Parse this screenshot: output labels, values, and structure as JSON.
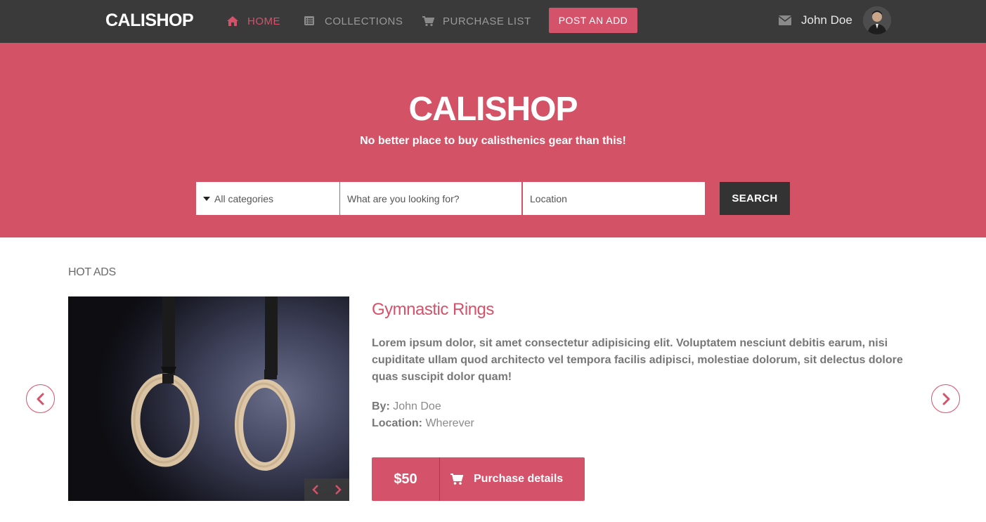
{
  "nav": {
    "brand": "CALISHOP",
    "items": [
      {
        "label": "HOME",
        "icon": "home-icon",
        "active": true
      },
      {
        "label": "COLLECTIONS",
        "icon": "list-icon",
        "active": false
      },
      {
        "label": "PURCHASE LIST",
        "icon": "cart-icon",
        "active": false
      }
    ],
    "post_button": "POST AN ADD",
    "user_name": "John Doe"
  },
  "hero": {
    "title": "CALISHOP",
    "subtitle": "No better place to buy calisthenics gear than this!",
    "category_select": "All categories",
    "search_placeholder": "What are you looking for?",
    "location_placeholder": "Location",
    "search_button": "SEARCH"
  },
  "hot_ads": {
    "heading": "HOT ADS",
    "ad": {
      "title": "Gymnastic Rings",
      "description": "Lorem ipsum dolor, sit amet consectetur adipisicing elit. Voluptatem nesciunt debitis earum, nisi cupiditate ullam quod architecto vel tempora facilis adipisci, molestiae dolorum, sit delectus dolore quas suscipit dolor quam!",
      "by_label": "By:",
      "by_value": "John Doe",
      "location_label": "Location:",
      "location_value": "Wherever",
      "price": "$50",
      "details_button": "Purchase details"
    }
  },
  "colors": {
    "accent": "#d4526a",
    "navbar": "#3a3a3a",
    "hero": "#d35266"
  }
}
